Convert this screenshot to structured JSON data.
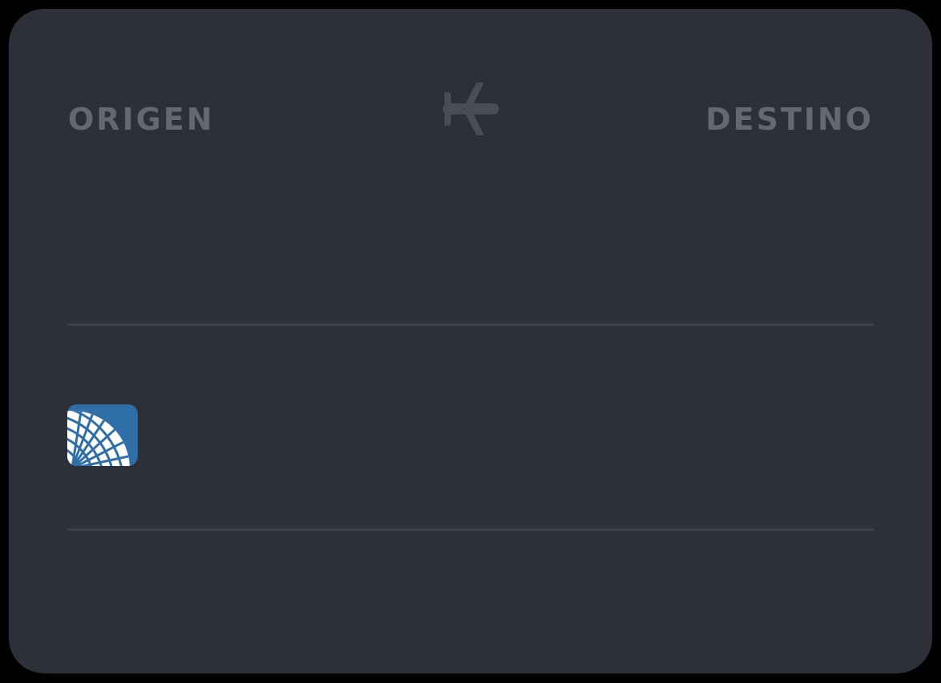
{
  "route": {
    "origin_label": "ORIGEN",
    "destination_label": "DESTINO",
    "plane_icon": "airplane-icon"
  },
  "airline": {
    "logo_icon": "airline-globe-logo"
  },
  "colors": {
    "background": "#000000",
    "card": "#2d2f39",
    "label": "#656873",
    "divider": "#3d404a",
    "logo_blue": "#2f6ea8"
  }
}
